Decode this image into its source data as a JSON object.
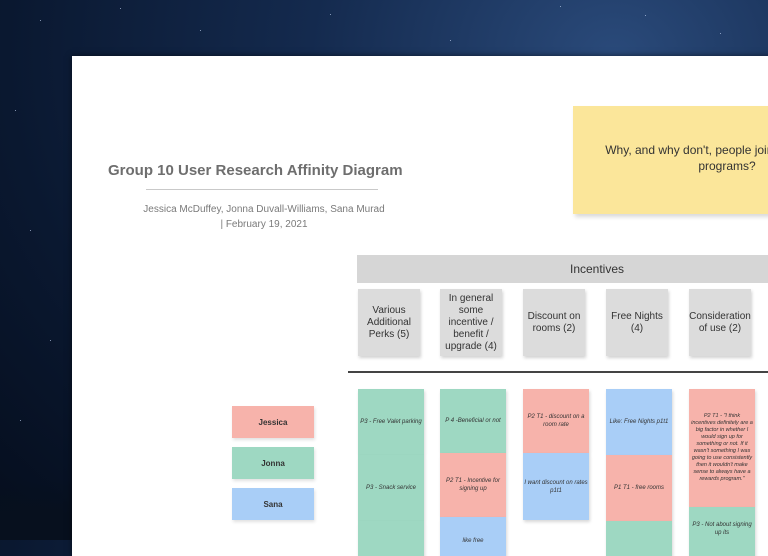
{
  "board": {
    "title": "Group 10 User Research Affinity Diagram",
    "authors": "Jessica McDuffey, Jonna Duvall-Williams, Sana Murad",
    "date": "| February 19, 2021",
    "question": "Why, and why don't, people join hotel rewards programs?"
  },
  "incentives": {
    "header": "Incentives",
    "columns": [
      "Various Additional Perks (5)",
      "In general some incentive / benefit / upgrade (4)",
      "Discount on rooms (2)",
      "Free Nights (4)",
      "Consideration of use (2)"
    ]
  },
  "legend": [
    {
      "label": "Jessica",
      "color": "#f7b3ab"
    },
    {
      "label": "Jonna",
      "color": "#9ed8c2"
    },
    {
      "label": "Sana",
      "color": "#a9cef7"
    }
  ],
  "notes": {
    "c1_1": "P3 - Free Valet parking",
    "c1_2": "P3 - Snack service",
    "c2_1": "P 4 -Beneficial or not",
    "c2_2": "P2 T1 - Incentive for signing up",
    "c2_3": "like free",
    "c3_1": "P2 T1 - discount on a room rate",
    "c3_2": "I want discount on rates p1t1",
    "c4_1": "Like: Free Nights p1t1",
    "c4_2": "P1 T1 - free rooms",
    "c5_1": "P2 T1 - \"I think incentives definitely are a big factor in whether I would sign up for something or not. If it wasn't something I was going to use consistently then it wouldn't make sense to always have a rewards program.\"",
    "c5_2": "P3 - Not about signing up its"
  }
}
